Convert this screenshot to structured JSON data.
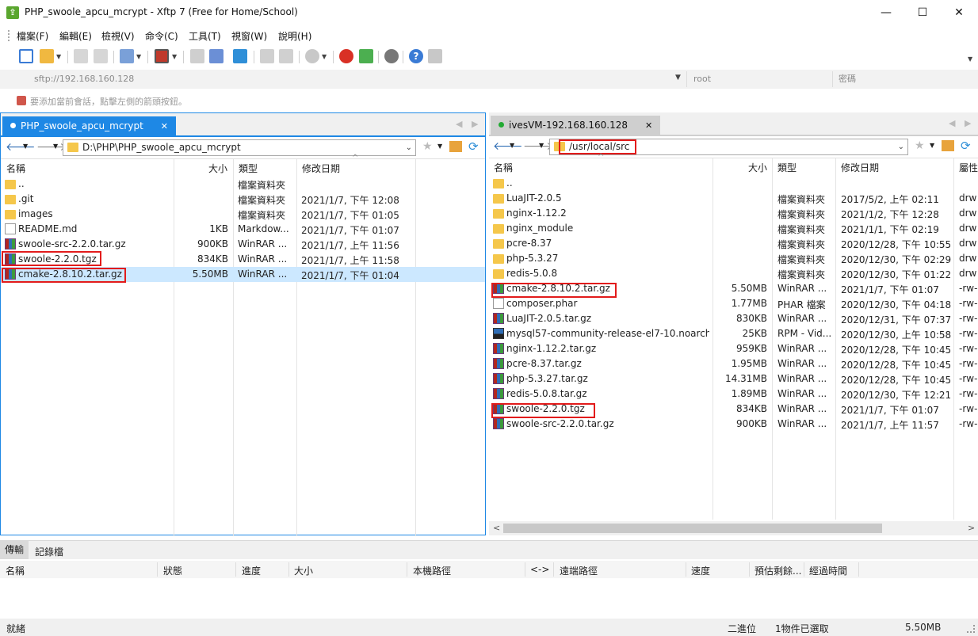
{
  "window": {
    "title": "PHP_swoole_apcu_mcrypt - Xftp 7 (Free for Home/School)",
    "minimize": "—",
    "maximize": "☐",
    "close": "✕"
  },
  "menu": [
    "檔案(F)",
    "編輯(E)",
    "檢視(V)",
    "命令(C)",
    "工具(T)",
    "視窗(W)",
    "說明(H)"
  ],
  "address": {
    "host_placeholder": "sftp://192.168.160.128",
    "user_placeholder": "root",
    "password_placeholder": "密碼"
  },
  "hint": "要添加當前會話，點擊左側的箭頭按鈕。",
  "left_pane": {
    "tab_label": "PHP_swoole_apcu_mcrypt",
    "path": "D:\\PHP\\PHP_swoole_apcu_mcrypt",
    "columns": [
      "名稱",
      "大小",
      "類型",
      "修改日期"
    ],
    "files": [
      {
        "name": "..",
        "size": "",
        "type": "檔案資料夾",
        "date": "",
        "icon": "folder-icon"
      },
      {
        "name": ".git",
        "size": "",
        "type": "檔案資料夾",
        "date": "2021/1/7, 下午 12:08",
        "icon": "folder-icon"
      },
      {
        "name": "images",
        "size": "",
        "type": "檔案資料夾",
        "date": "2021/1/7, 下午 01:05",
        "icon": "folder-icon"
      },
      {
        "name": "README.md",
        "size": "1KB",
        "type": "Markdow...",
        "date": "2021/1/7, 下午 01:07",
        "icon": "file-icon"
      },
      {
        "name": "swoole-src-2.2.0.tar.gz",
        "size": "900KB",
        "type": "WinRAR ...",
        "date": "2021/1/7, 上午 11:56",
        "icon": "rar-icon"
      },
      {
        "name": "swoole-2.2.0.tgz",
        "size": "834KB",
        "type": "WinRAR ...",
        "date": "2021/1/7, 上午 11:58",
        "icon": "rar-icon"
      },
      {
        "name": "cmake-2.8.10.2.tar.gz",
        "size": "5.50MB",
        "type": "WinRAR ...",
        "date": "2021/1/7, 下午 01:04",
        "icon": "rar-icon"
      }
    ]
  },
  "right_pane": {
    "tab_label": "ivesVM-192.168.160.128",
    "path": "/usr/local/src",
    "columns": [
      "名稱",
      "大小",
      "類型",
      "修改日期",
      "屬性"
    ],
    "files": [
      {
        "name": "..",
        "size": "",
        "type": "",
        "date": "",
        "attr": "",
        "icon": "folder-icon"
      },
      {
        "name": "LuaJIT-2.0.5",
        "size": "",
        "type": "檔案資料夾",
        "date": "2017/5/2, 上午 02:11",
        "attr": "drw",
        "icon": "folder-icon"
      },
      {
        "name": "nginx-1.12.2",
        "size": "",
        "type": "檔案資料夾",
        "date": "2021/1/2, 下午 12:28",
        "attr": "drw",
        "icon": "folder-icon"
      },
      {
        "name": "nginx_module",
        "size": "",
        "type": "檔案資料夾",
        "date": "2021/1/1, 下午 02:19",
        "attr": "drw",
        "icon": "folder-icon"
      },
      {
        "name": "pcre-8.37",
        "size": "",
        "type": "檔案資料夾",
        "date": "2020/12/28, 下午 10:55",
        "attr": "drw",
        "icon": "folder-icon"
      },
      {
        "name": "php-5.3.27",
        "size": "",
        "type": "檔案資料夾",
        "date": "2020/12/30, 下午 02:29",
        "attr": "drw",
        "icon": "folder-icon"
      },
      {
        "name": "redis-5.0.8",
        "size": "",
        "type": "檔案資料夾",
        "date": "2020/12/30, 下午 01:22",
        "attr": "drw",
        "icon": "folder-icon"
      },
      {
        "name": "cmake-2.8.10.2.tar.gz",
        "size": "5.50MB",
        "type": "WinRAR ...",
        "date": "2021/1/7, 下午 01:07",
        "attr": "-rw-",
        "icon": "rar-icon"
      },
      {
        "name": "composer.phar",
        "size": "1.77MB",
        "type": "PHAR 檔案",
        "date": "2020/12/30, 下午 04:18",
        "attr": "-rw-",
        "icon": "file-icon"
      },
      {
        "name": "LuaJIT-2.0.5.tar.gz",
        "size": "830KB",
        "type": "WinRAR ...",
        "date": "2020/12/31, 下午 07:37",
        "attr": "-rw-",
        "icon": "rar-icon"
      },
      {
        "name": "mysql57-community-release-el7-10.noarch....",
        "size": "25KB",
        "type": "RPM - Vid...",
        "date": "2020/12/30, 上午 10:58",
        "attr": "-rw-",
        "icon": "rpm-icon"
      },
      {
        "name": "nginx-1.12.2.tar.gz",
        "size": "959KB",
        "type": "WinRAR ...",
        "date": "2020/12/28, 下午 10:45",
        "attr": "-rw-",
        "icon": "rar-icon"
      },
      {
        "name": "pcre-8.37.tar.gz",
        "size": "1.95MB",
        "type": "WinRAR ...",
        "date": "2020/12/28, 下午 10:45",
        "attr": "-rw-",
        "icon": "rar-icon"
      },
      {
        "name": "php-5.3.27.tar.gz",
        "size": "14.31MB",
        "type": "WinRAR ...",
        "date": "2020/12/28, 下午 10:45",
        "attr": "-rw-",
        "icon": "rar-icon"
      },
      {
        "name": "redis-5.0.8.tar.gz",
        "size": "1.89MB",
        "type": "WinRAR ...",
        "date": "2020/12/30, 下午 12:21",
        "attr": "-rw-",
        "icon": "rar-icon"
      },
      {
        "name": "swoole-2.2.0.tgz",
        "size": "834KB",
        "type": "WinRAR ...",
        "date": "2021/1/7, 下午 01:07",
        "attr": "-rw-",
        "icon": "rar-icon"
      },
      {
        "name": "swoole-src-2.2.0.tar.gz",
        "size": "900KB",
        "type": "WinRAR ...",
        "date": "2021/1/7, 上午 11:57",
        "attr": "-rw-",
        "icon": "rar-icon"
      }
    ]
  },
  "transfer": {
    "tabs": [
      "傳輸",
      "記錄檔"
    ],
    "columns": [
      "名稱",
      "狀態",
      "進度",
      "大小",
      "本機路徑",
      "<->",
      "遠端路徑",
      "速度",
      "預估剩餘...",
      "經過時間"
    ]
  },
  "status": {
    "ready": "就緒",
    "mode": "二進位",
    "selected": "1物件已選取",
    "size": "5.50MB"
  },
  "colors": {
    "accent_blue": "#1e88e5",
    "highlight_red": "#e21b1b",
    "selection": "#cce8ff",
    "connected_green": "#22aa33"
  }
}
